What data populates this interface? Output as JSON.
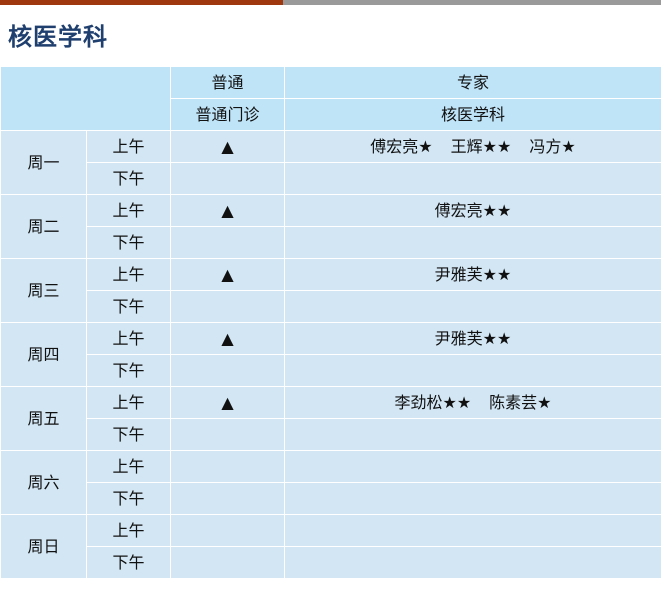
{
  "title": "核医学科",
  "header": {
    "row1": {
      "general": "普通",
      "expert": "专家"
    },
    "row2": {
      "general": "普通门诊",
      "expert": "核医学科"
    }
  },
  "periods": {
    "am": "上午",
    "pm": "下午"
  },
  "days": [
    {
      "label": "周一",
      "am_general": "▲",
      "am_experts": [
        "傅宏亮★",
        "王辉★★",
        "冯方★"
      ],
      "pm_general": "",
      "pm_experts": []
    },
    {
      "label": "周二",
      "am_general": "▲",
      "am_experts": [
        "傅宏亮★★"
      ],
      "pm_general": "",
      "pm_experts": []
    },
    {
      "label": "周三",
      "am_general": "▲",
      "am_experts": [
        "尹雅芙★★"
      ],
      "pm_general": "",
      "pm_experts": []
    },
    {
      "label": "周四",
      "am_general": "▲",
      "am_experts": [
        "尹雅芙★★"
      ],
      "pm_general": "",
      "pm_experts": []
    },
    {
      "label": "周五",
      "am_general": "▲",
      "am_experts": [
        "李劲松★★",
        "陈素芸★"
      ],
      "pm_general": "",
      "pm_experts": []
    },
    {
      "label": "周六",
      "am_general": "",
      "am_experts": [],
      "pm_general": "",
      "pm_experts": []
    },
    {
      "label": "周日",
      "am_general": "",
      "am_experts": [],
      "pm_general": "",
      "pm_experts": []
    }
  ],
  "colors": {
    "title": "#1f3f6e",
    "top_bar_left": "#a0380f",
    "top_bar_right": "#9a9a9a",
    "header_bg": "#bfe4f7",
    "cell_bg": "#d2e6f4"
  }
}
